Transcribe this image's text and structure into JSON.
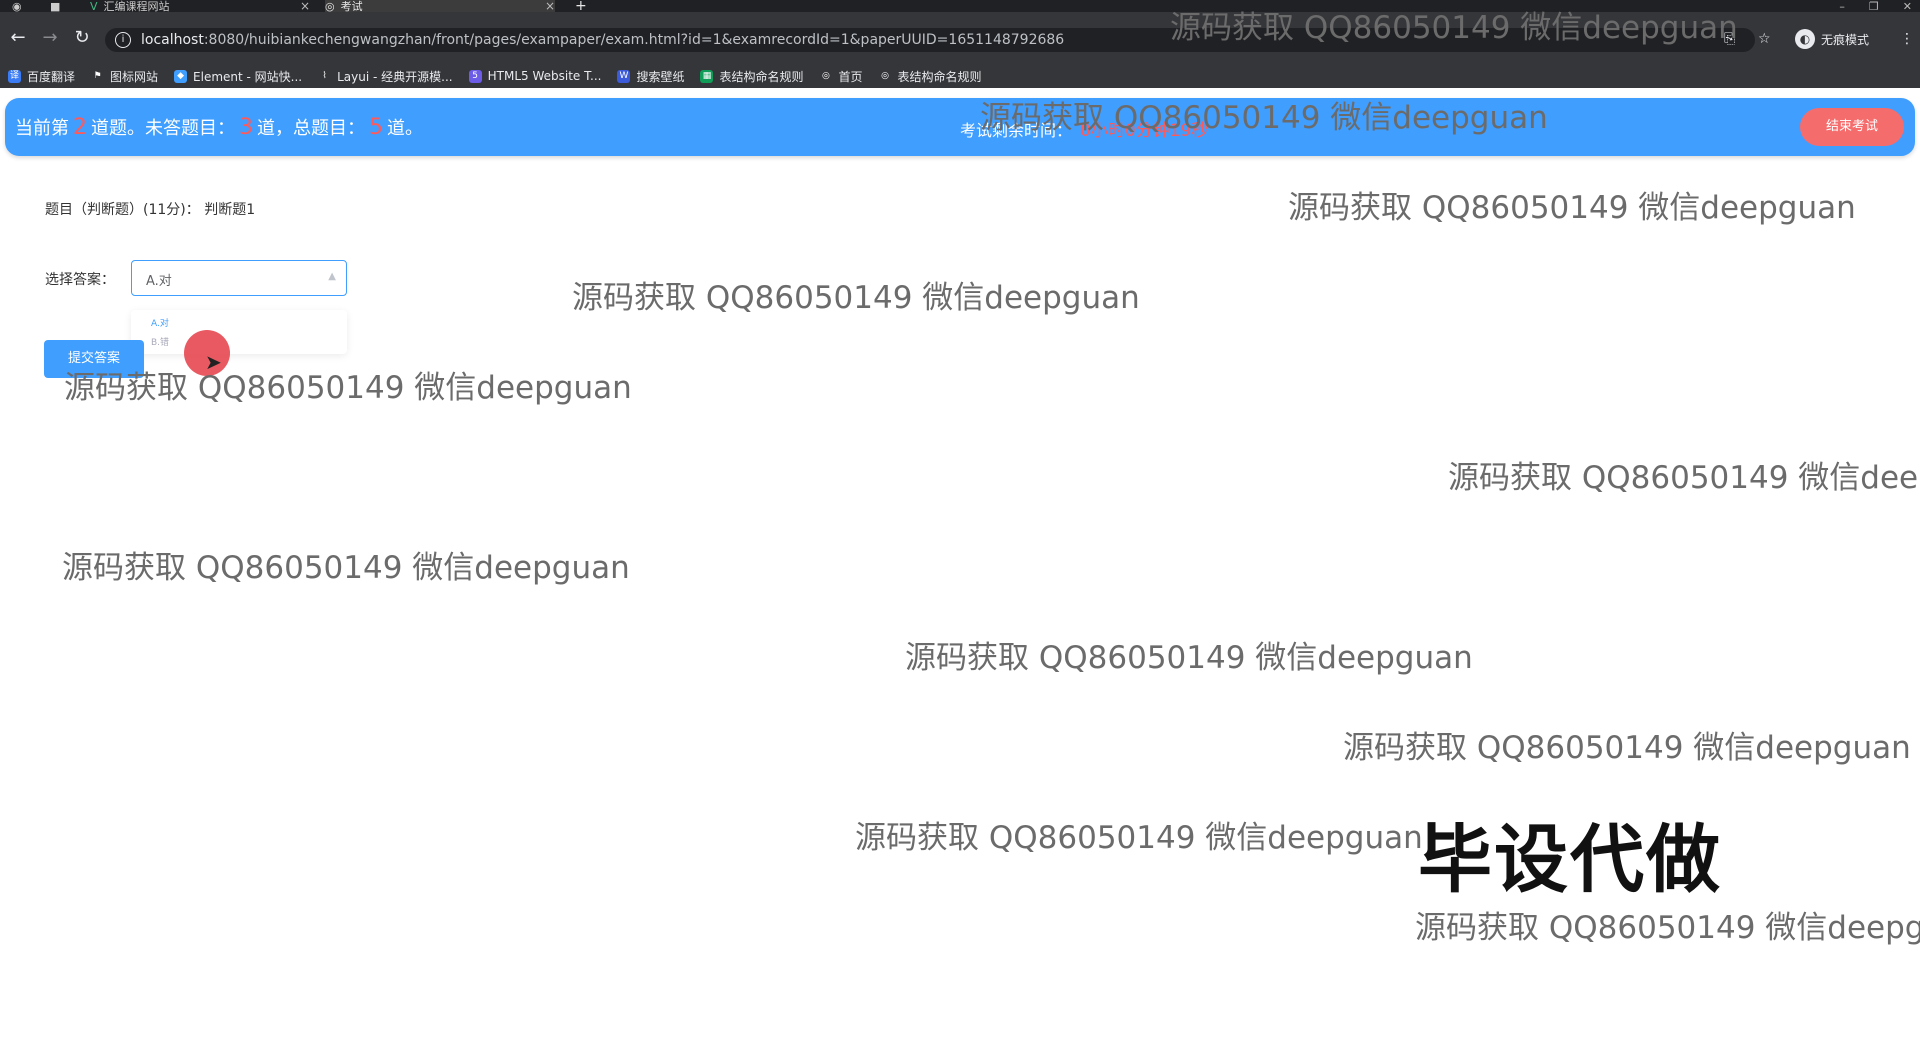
{
  "browser": {
    "tabs": [
      {
        "title": "汇编课程网站"
      },
      {
        "title": "考试"
      }
    ],
    "new_tab": "+",
    "url_host": "localhost",
    "url_rest": ":8080/huibiankechengwangzhan/front/pages/exampaper/exam.html?id=1&examrecordId=1&paperUUID=1651148792686",
    "incognito_label": "无痕模式",
    "bookmarks": [
      {
        "label": "百度翻译",
        "icon": "translate-icon"
      },
      {
        "label": "图标网站",
        "icon": "flag-icon"
      },
      {
        "label": "Element - 网站快...",
        "icon": "element-icon"
      },
      {
        "label": "Layui - 经典开源模...",
        "icon": "layui-icon"
      },
      {
        "label": "HTML5 Website T...",
        "icon": "html5-icon"
      },
      {
        "label": "搜索壁纸",
        "icon": "wallpaper-icon"
      },
      {
        "label": "表结构命名规则",
        "icon": "sheet-icon"
      },
      {
        "label": "首页",
        "icon": "globe-icon"
      },
      {
        "label": "表结构命名规则",
        "icon": "globe-icon"
      }
    ]
  },
  "exam": {
    "status_prefix": "当前第",
    "current_num": "2",
    "status_mid1": "道题。未答题目：",
    "unanswered_num": "3",
    "status_mid2": "道，总题目：",
    "total_num": "5",
    "status_suffix": "道。",
    "timer_label": "考试剩余时间：",
    "timer_value": "0小时0分钟19秒",
    "end_button": "结束考试",
    "question_text": "题目（判断题）(11分)：  判断题1",
    "answer_label": "选择答案：",
    "selected_answer": "A.对",
    "options": [
      "A.对",
      "B.错"
    ],
    "submit_button": "提交答案"
  },
  "watermark": {
    "text": "源码获取 QQ86050149 微信deepguan",
    "big_text": "毕设代做"
  }
}
